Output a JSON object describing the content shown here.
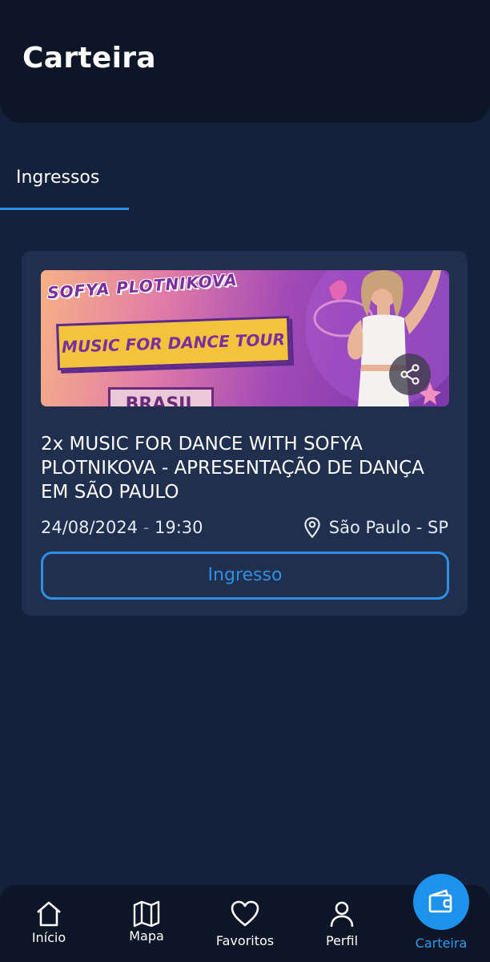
{
  "header": {
    "title": "Carteira"
  },
  "tabs": [
    {
      "label": "Ingressos",
      "active": true
    }
  ],
  "ticket_card": {
    "banner": {
      "artist_text": "SOFYA PLOTNIKOVA",
      "tour_text": "MUSIC FOR DANCE TOUR",
      "country_text": "BRASIL"
    },
    "title": "2x MUSIC FOR DANCE WITH SOFYA PLOTNIKOVA - APRESENTAÇÃO DE DANÇA EM SÃO PAULO",
    "date": "24/08/2024",
    "date_separator": "-",
    "time": "19:30",
    "location": "São Paulo - SP",
    "button_label": "Ingresso"
  },
  "bottom_nav": {
    "items": [
      {
        "label": "Início",
        "icon": "home-icon"
      },
      {
        "label": "Mapa",
        "icon": "map-icon"
      },
      {
        "label": "Favoritos",
        "icon": "heart-icon"
      },
      {
        "label": "Perfil",
        "icon": "user-icon"
      },
      {
        "label": "Carteira",
        "icon": "wallet-icon",
        "active": true
      }
    ]
  },
  "colors": {
    "background": "#13213a",
    "header_bg": "#0c1627",
    "card_bg": "#1f2f4d",
    "accent": "#2f8fe6",
    "active_nav": "#1e93ee"
  }
}
